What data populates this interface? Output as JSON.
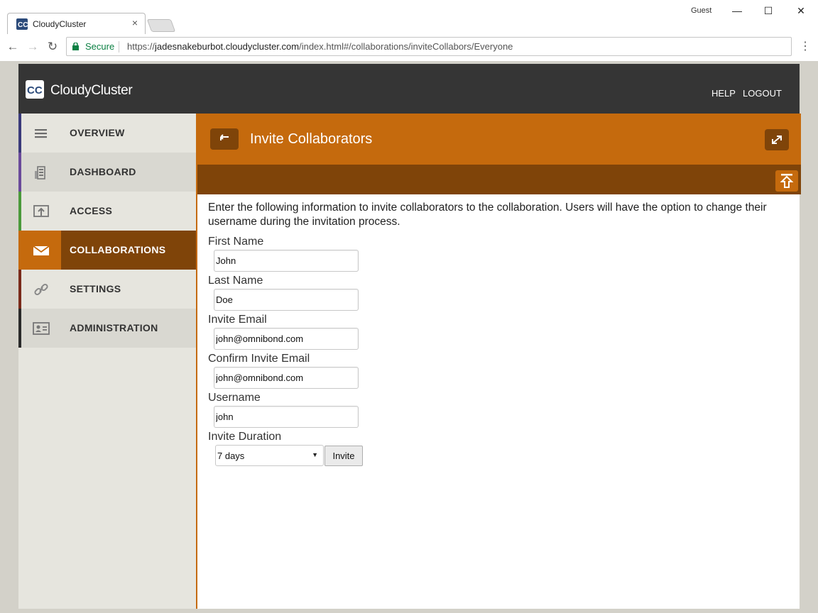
{
  "browser": {
    "tab_title": "CloudyCluster",
    "tab_close": "×",
    "profile": "Guest",
    "window_controls": [
      "minimize",
      "maximize",
      "close"
    ],
    "secure_label": "Secure",
    "url_scheme": "https://",
    "url_host": "jadesnakeburbot.cloudycluster.com",
    "url_path": "/index.html#/collaborations/inviteCollabors/Everyone"
  },
  "header": {
    "brand": "CloudyCluster",
    "help": "HELP",
    "logout": "LOGOUT"
  },
  "sidebar": {
    "items": [
      {
        "label": "OVERVIEW",
        "icon": "menu-icon",
        "bar_color": "#3a3a7a"
      },
      {
        "label": "DASHBOARD",
        "icon": "dashboard-icon",
        "bar_color": "#6a4a9a"
      },
      {
        "label": "ACCESS",
        "icon": "access-icon",
        "bar_color": "#4a9a3a"
      },
      {
        "label": "COLLABORATIONS",
        "icon": "envelope-icon",
        "active": true
      },
      {
        "label": "SETTINGS",
        "icon": "link-icon",
        "bar_color": "#7a2a1a"
      },
      {
        "label": "ADMINISTRATION",
        "icon": "id-card-icon",
        "bar_color": "#2a2a2a"
      }
    ]
  },
  "content": {
    "title": "Invite Collaborators",
    "intro": "Enter the following information to invite collaborators to the collaboration. Users will have the option to change their username during the invitation process.",
    "fields": {
      "first_name": {
        "label": "First Name",
        "value": "John"
      },
      "last_name": {
        "label": "Last Name",
        "value": "Doe"
      },
      "invite_email": {
        "label": "Invite Email",
        "value": "john@omnibond.com"
      },
      "confirm_email": {
        "label": "Confirm Invite Email",
        "value": "john@omnibond.com"
      },
      "username": {
        "label": "Username",
        "value": "john"
      },
      "duration": {
        "label": "Invite Duration",
        "value": "7 days"
      }
    },
    "invite_button": "Invite"
  },
  "colors": {
    "accent_orange": "#c56a0d",
    "accent_brown": "#7f4409",
    "header_dark": "#353535"
  }
}
